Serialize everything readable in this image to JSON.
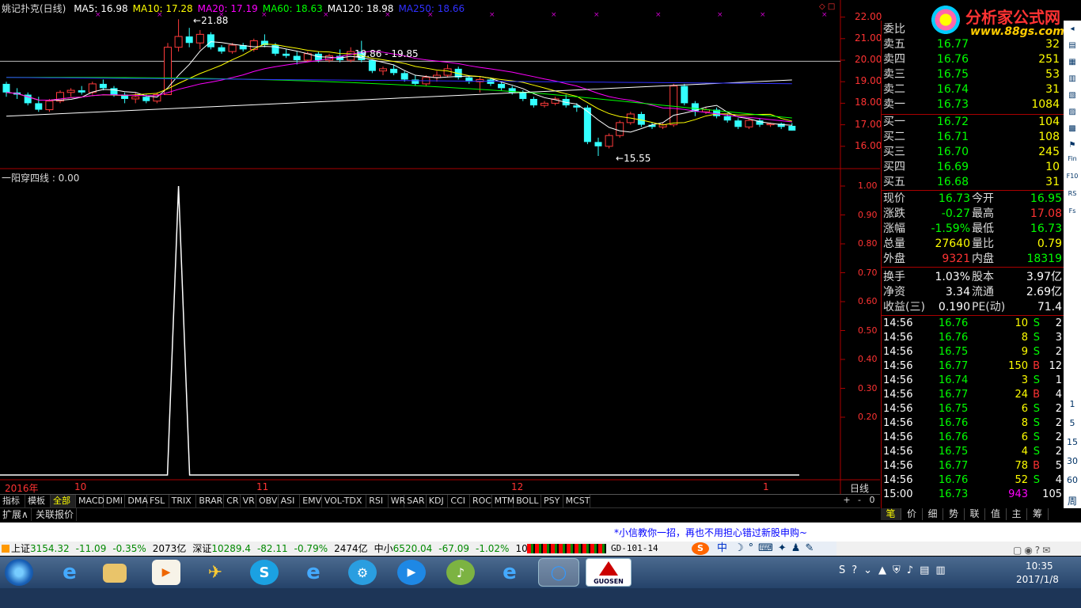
{
  "header": {
    "title": "姚记扑克(日线)",
    "ma": [
      {
        "label": "MA5: 16.98",
        "color": "#ffffff"
      },
      {
        "label": "MA10: 17.28",
        "color": "#ffff00"
      },
      {
        "label": "MA20: 17.19",
        "color": "#ff00ff"
      },
      {
        "label": "MA60: 18.63",
        "color": "#00ff00"
      },
      {
        "label": "MA120: 18.98",
        "color": "#ffffff"
      },
      {
        "label": "MA250: 18.66",
        "color": "#3030ff"
      }
    ]
  },
  "price_axis": [
    "22.00",
    "21.00",
    "20.00",
    "19.00",
    "18.00",
    "17.00",
    "16.00"
  ],
  "annotations": {
    "high": "21.88",
    "range": "19.86 - 19.85",
    "low": "15.55"
  },
  "indicator": {
    "title": "一阳穿四线 : 0.00",
    "axis": [
      "1.00",
      "0.90",
      "0.80",
      "0.70",
      "0.60",
      "0.50",
      "0.40",
      "0.30",
      "0.20"
    ]
  },
  "date_axis": [
    "2016年",
    "10",
    "11",
    "12",
    "1"
  ],
  "period_label": "日线",
  "logo": {
    "brand": "分析家公式网",
    "url": "www.88gs.com"
  },
  "order_book": {
    "ratio_label": "委比",
    "asks": [
      {
        "label": "卖五",
        "price": "16.77",
        "vol": "32"
      },
      {
        "label": "卖四",
        "price": "16.76",
        "vol": "251"
      },
      {
        "label": "卖三",
        "price": "16.75",
        "vol": "53"
      },
      {
        "label": "卖二",
        "price": "16.74",
        "vol": "31"
      },
      {
        "label": "卖一",
        "price": "16.73",
        "vol": "1084"
      }
    ],
    "bids": [
      {
        "label": "买一",
        "price": "16.72",
        "vol": "104"
      },
      {
        "label": "买二",
        "price": "16.71",
        "vol": "108"
      },
      {
        "label": "买三",
        "price": "16.70",
        "vol": "245"
      },
      {
        "label": "买四",
        "price": "16.69",
        "vol": "10"
      },
      {
        "label": "买五",
        "price": "16.68",
        "vol": "31"
      }
    ]
  },
  "quote": [
    {
      "l1": "现价",
      "v1": "16.73",
      "c1": "#00ff00",
      "l2": "今开",
      "v2": "16.95",
      "c2": "#00ff00"
    },
    {
      "l1": "涨跌",
      "v1": "-0.27",
      "c1": "#00ff00",
      "l2": "最高",
      "v2": "17.08",
      "c2": "#ff3333"
    },
    {
      "l1": "涨幅",
      "v1": "-1.59%",
      "c1": "#00ff00",
      "l2": "最低",
      "v2": "16.73",
      "c2": "#00ff00"
    },
    {
      "l1": "总量",
      "v1": "27640",
      "c1": "#ffff00",
      "l2": "量比",
      "v2": "0.79",
      "c2": "#ffff00"
    },
    {
      "l1": "外盘",
      "v1": "9321",
      "c1": "#ff3333",
      "l2": "内盘",
      "v2": "18319",
      "c2": "#00ff00"
    },
    {
      "l1": "换手",
      "v1": "1.03%",
      "c1": "#ffffff",
      "l2": "股本",
      "v2": "3.97亿",
      "c2": "#ffffff"
    },
    {
      "l1": "净资",
      "v1": "3.34",
      "c1": "#ffffff",
      "l2": "流通",
      "v2": "2.69亿",
      "c2": "#ffffff"
    },
    {
      "l1": "收益(三)",
      "v1": "0.190",
      "c1": "#ffffff",
      "l2": "PE(动)",
      "v2": "71.4",
      "c2": "#ffffff"
    }
  ],
  "ticks": [
    {
      "time": "14:56",
      "price": "16.76",
      "vol": "10",
      "side": "S",
      "cnt": "2"
    },
    {
      "time": "14:56",
      "price": "16.76",
      "vol": "8",
      "side": "S",
      "cnt": "3"
    },
    {
      "time": "14:56",
      "price": "16.75",
      "vol": "9",
      "side": "S",
      "cnt": "2"
    },
    {
      "time": "14:56",
      "price": "16.77",
      "vol": "150",
      "side": "B",
      "cnt": "12"
    },
    {
      "time": "14:56",
      "price": "16.74",
      "vol": "3",
      "side": "S",
      "cnt": "1"
    },
    {
      "time": "14:56",
      "price": "16.77",
      "vol": "24",
      "side": "B",
      "cnt": "4"
    },
    {
      "time": "14:56",
      "price": "16.75",
      "vol": "6",
      "side": "S",
      "cnt": "2"
    },
    {
      "time": "14:56",
      "price": "16.76",
      "vol": "8",
      "side": "S",
      "cnt": "2"
    },
    {
      "time": "14:56",
      "price": "16.76",
      "vol": "6",
      "side": "S",
      "cnt": "2"
    },
    {
      "time": "14:56",
      "price": "16.75",
      "vol": "4",
      "side": "S",
      "cnt": "2"
    },
    {
      "time": "14:56",
      "price": "16.77",
      "vol": "78",
      "side": "B",
      "cnt": "5"
    },
    {
      "time": "14:56",
      "price": "16.76",
      "vol": "52",
      "side": "S",
      "cnt": "4"
    },
    {
      "time": "15:00",
      "price": "16.73",
      "vol": "943",
      "side": "",
      "cnt": "105"
    }
  ],
  "indicator_tabs": [
    "指标",
    "模板",
    "全部",
    "MACD",
    "DMI",
    "DMA",
    "FSL",
    "TRIX",
    "BRAR",
    "CR",
    "VR",
    "OBV",
    "ASI",
    "EMV",
    "VOL-TDX",
    "RSI",
    "WR",
    "SAR",
    "KDJ",
    "CCI",
    "ROC",
    "MTM",
    "BOLL",
    "PSY",
    "MCST"
  ],
  "indicator_nav": [
    "+",
    "-",
    "0"
  ],
  "ext_tabs": [
    "扩展∧",
    "关联报价"
  ],
  "panel_tabs": [
    "笔",
    "价",
    "细",
    "势",
    "联",
    "值",
    "主",
    "筹"
  ],
  "panel_more": "周",
  "news": "*小信教你一招，再也不用担心错过新股申购~",
  "indices": [
    {
      "name": "上证",
      "value": "3154.32",
      "chg": "-11.09",
      "pct": "-0.35%",
      "amt": "2073亿"
    },
    {
      "name": "深证",
      "value": "10289.4",
      "chg": "-82.11",
      "pct": "-0.79%",
      "amt": "2474亿"
    },
    {
      "name": "中小",
      "value": "6520.04",
      "chg": "-67.09",
      "pct": "-1.02%",
      "amt": "1010亿"
    }
  ],
  "server": "GD-101-14",
  "ime": "中",
  "taskbar": {
    "time": "10:35",
    "date": "2017/1/8",
    "app_label": "GUOSEN"
  },
  "side_numbers": [
    "1",
    "5",
    "15",
    "30",
    "60"
  ],
  "side_labels": [
    "Fin",
    "F10",
    "RS",
    "Fs"
  ],
  "chart_data": {
    "type": "candlestick",
    "title": "姚记扑克(日线)",
    "y_range": [
      15.0,
      22.5
    ],
    "note_high": 21.88,
    "note_low": 15.55,
    "candles": [
      [
        18.9,
        19.0,
        18.3,
        18.5
      ],
      [
        18.5,
        18.7,
        18.2,
        18.4
      ],
      [
        18.4,
        18.5,
        17.9,
        18.0
      ],
      [
        18.0,
        18.3,
        17.6,
        17.7
      ],
      [
        17.7,
        18.2,
        17.6,
        18.1
      ],
      [
        18.1,
        18.6,
        18.0,
        18.5
      ],
      [
        18.5,
        18.7,
        18.3,
        18.6
      ],
      [
        18.6,
        18.8,
        18.4,
        18.5
      ],
      [
        18.5,
        19.0,
        18.4,
        18.9
      ],
      [
        18.9,
        19.1,
        18.6,
        18.7
      ],
      [
        18.7,
        18.8,
        18.3,
        18.4
      ],
      [
        18.4,
        18.5,
        18.0,
        18.2
      ],
      [
        18.2,
        18.5,
        18.0,
        18.3
      ],
      [
        18.3,
        18.4,
        18.0,
        18.1
      ],
      [
        18.1,
        18.5,
        18.0,
        18.4
      ],
      [
        18.4,
        20.8,
        18.4,
        20.6
      ],
      [
        20.6,
        21.9,
        20.4,
        21.1
      ],
      [
        21.1,
        21.5,
        20.6,
        20.8
      ],
      [
        20.8,
        21.4,
        20.5,
        21.2
      ],
      [
        21.2,
        21.3,
        20.5,
        20.6
      ],
      [
        20.6,
        20.7,
        20.3,
        20.4
      ],
      [
        20.4,
        20.8,
        20.3,
        20.7
      ],
      [
        20.7,
        20.8,
        20.4,
        20.5
      ],
      [
        20.5,
        21.0,
        20.4,
        20.9
      ],
      [
        20.9,
        21.2,
        20.6,
        20.7
      ],
      [
        20.7,
        20.8,
        20.2,
        20.3
      ],
      [
        20.3,
        20.5,
        20.1,
        20.2
      ],
      [
        20.2,
        20.4,
        19.8,
        20.0
      ],
      [
        20.0,
        20.4,
        19.9,
        20.3
      ],
      [
        20.3,
        20.4,
        19.9,
        20.0
      ],
      [
        20.0,
        20.3,
        19.9,
        20.2
      ],
      [
        20.2,
        20.5,
        19.9,
        20.0
      ],
      [
        20.0,
        20.6,
        19.9,
        20.4
      ],
      [
        20.4,
        20.9,
        19.9,
        20.0
      ],
      [
        20.0,
        20.0,
        19.4,
        19.5
      ],
      [
        19.5,
        19.7,
        19.3,
        19.6
      ],
      [
        19.6,
        19.8,
        19.3,
        19.4
      ],
      [
        19.4,
        19.5,
        19.0,
        19.1
      ],
      [
        19.1,
        19.3,
        18.8,
        18.9
      ],
      [
        18.9,
        19.3,
        18.8,
        19.2
      ],
      [
        19.2,
        19.5,
        19.0,
        19.3
      ],
      [
        19.3,
        19.8,
        19.2,
        19.6
      ],
      [
        19.6,
        19.7,
        19.1,
        19.2
      ],
      [
        19.2,
        19.3,
        18.9,
        19.0
      ],
      [
        19.0,
        19.2,
        18.5,
        19.1
      ],
      [
        19.1,
        19.2,
        18.8,
        18.9
      ],
      [
        18.9,
        19.0,
        18.6,
        18.7
      ],
      [
        18.7,
        18.8,
        18.4,
        18.5
      ],
      [
        18.5,
        18.6,
        18.1,
        18.2
      ],
      [
        18.2,
        18.3,
        17.8,
        17.9
      ],
      [
        17.9,
        18.1,
        17.8,
        18.0
      ],
      [
        18.0,
        18.3,
        17.9,
        18.2
      ],
      [
        18.2,
        18.4,
        17.8,
        17.9
      ],
      [
        17.9,
        18.0,
        17.6,
        17.8
      ],
      [
        17.8,
        17.9,
        16.1,
        16.2
      ],
      [
        16.2,
        16.4,
        15.55,
        16.0
      ],
      [
        16.0,
        16.6,
        15.9,
        16.5
      ],
      [
        16.5,
        17.2,
        16.4,
        17.1
      ],
      [
        17.1,
        17.6,
        17.0,
        17.5
      ],
      [
        17.5,
        17.6,
        16.9,
        17.0
      ],
      [
        17.0,
        17.1,
        16.8,
        16.9
      ],
      [
        16.9,
        17.1,
        16.8,
        17.0
      ],
      [
        17.0,
        18.9,
        16.9,
        18.8
      ],
      [
        18.8,
        18.9,
        17.9,
        18.0
      ],
      [
        18.0,
        18.1,
        17.4,
        17.6
      ],
      [
        17.6,
        17.8,
        17.5,
        17.7
      ],
      [
        17.7,
        17.8,
        17.3,
        17.4
      ],
      [
        17.4,
        17.5,
        17.1,
        17.2
      ],
      [
        17.2,
        17.3,
        16.8,
        16.9
      ],
      [
        16.9,
        17.3,
        16.8,
        17.2
      ],
      [
        17.2,
        17.3,
        16.9,
        17.0
      ],
      [
        17.0,
        17.1,
        16.9,
        17.05
      ],
      [
        17.05,
        17.1,
        16.8,
        16.9
      ],
      [
        16.95,
        17.08,
        16.73,
        16.73
      ]
    ],
    "indicator_spike": {
      "index": 16,
      "value": 1.0
    },
    "indicator_range": [
      0.0,
      1.0
    ]
  }
}
